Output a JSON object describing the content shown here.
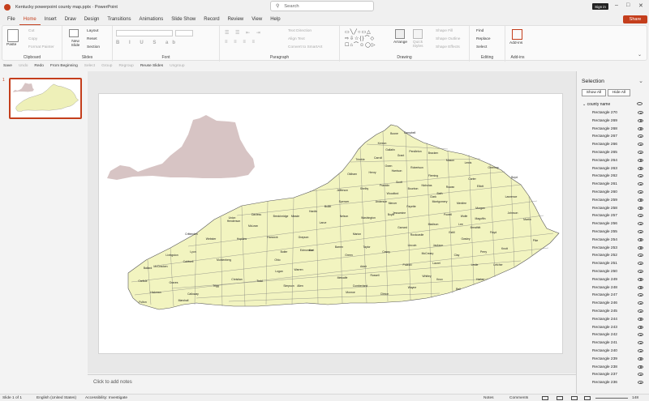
{
  "title": "Kentucky powerpoint county map.pptx  ·  PowerPoint",
  "search_placeholder": "Search",
  "sign_in": "Sign in",
  "share": "Share",
  "menu": [
    "File",
    "Home",
    "Insert",
    "Draw",
    "Design",
    "Transitions",
    "Animations",
    "Slide Show",
    "Record",
    "Review",
    "View",
    "Help"
  ],
  "ribbon": {
    "clipboard": {
      "paste": "Paste",
      "cut": "Cut",
      "copy": "Copy",
      "format_painter": "Format Painter",
      "label": "Clipboard"
    },
    "slides": {
      "new_slide": "New Slide",
      "layout": "Layout",
      "reset": "Reset",
      "section": "Section",
      "label": "Slides"
    },
    "font": {
      "label": "Font"
    },
    "paragraph": {
      "text_direction": "Text Direction",
      "align_text": "Align Text",
      "convert_smartart": "Convert to SmartArt",
      "label": "Paragraph"
    },
    "drawing": {
      "arrange": "Arrange",
      "quick_styles": "Quick Styles",
      "shape_fill": "Shape Fill",
      "shape_outline": "Shape Outline",
      "shape_effects": "Shape Effects",
      "label": "Drawing"
    },
    "editing": {
      "find": "Find",
      "replace": "Replace",
      "select": "Select",
      "label": "Editing"
    },
    "addins": {
      "addins": "Add-ins",
      "label": "Add-ins"
    }
  },
  "qat": [
    "Save",
    "Undo",
    "Redo",
    "From Beginning",
    "Select",
    "Group",
    "Regroup",
    "Reuse Slides",
    "Ungroup"
  ],
  "slide_number": "1",
  "notes_placeholder": "Click to add notes",
  "selection": {
    "title": "Selection",
    "show_all": "Show All",
    "hide_all": "Hide All",
    "root": "county name",
    "items": [
      "Rectangle 270",
      "Rectangle 269",
      "Rectangle 268",
      "Rectangle 267",
      "Rectangle 266",
      "Rectangle 265",
      "Rectangle 264",
      "Rectangle 263",
      "Rectangle 262",
      "Rectangle 261",
      "Rectangle 260",
      "Rectangle 259",
      "Rectangle 258",
      "Rectangle 257",
      "Rectangle 256",
      "Rectangle 255",
      "Rectangle 254",
      "Rectangle 253",
      "Rectangle 252",
      "Rectangle 251",
      "Rectangle 250",
      "Rectangle 249",
      "Rectangle 248",
      "Rectangle 247",
      "Rectangle 246",
      "Rectangle 245",
      "Rectangle 244",
      "Rectangle 243",
      "Rectangle 242",
      "Rectangle 241",
      "Rectangle 240",
      "Rectangle 239",
      "Rectangle 238",
      "Rectangle 237",
      "Rectangle 236"
    ]
  },
  "status": {
    "slide": "Slide 1 of 1",
    "language": "English (United States)",
    "accessibility": "Accessibility: Investigate",
    "notes": "Notes",
    "comments": "Comments",
    "zoom": "148"
  },
  "colors": {
    "accent": "#c43e1c",
    "county_fill": "#f2f4c0",
    "silhouette": "#d7c4c4"
  },
  "counties": [
    "Boone",
    "Campbell",
    "Kenton",
    "Gallatin",
    "Grant",
    "Pendleton",
    "Bracken",
    "Mason",
    "Lewis",
    "Greenup",
    "Carroll",
    "Trimble",
    "Oldham",
    "Henry",
    "Owen",
    "Harrison",
    "Robertson",
    "Fleming",
    "Carter",
    "Boyd",
    "Rowan",
    "Elliott",
    "Lawrence",
    "Bath",
    "Menifee",
    "Morgan",
    "Johnson",
    "Martin",
    "Jefferson",
    "Shelby",
    "Franklin",
    "Scott",
    "Bourbon",
    "Nicholas",
    "Clark",
    "Montgomery",
    "Powell",
    "Wolfe",
    "Magoffin",
    "Floyd",
    "Pike",
    "Knott",
    "Letcher",
    "Perry",
    "Breathitt",
    "Lee",
    "Estill",
    "Owsley",
    "Madison",
    "Jackson",
    "Clay",
    "Leslie",
    "Harlan",
    "Bell",
    "Knox",
    "Whitley",
    "Laurel",
    "McCreary",
    "Rockcastle",
    "Garrard",
    "Lincoln",
    "Pulaski",
    "Wayne",
    "Clinton",
    "Cumberland",
    "Russell",
    "Casey",
    "Adair",
    "Metcalfe",
    "Monroe",
    "Taylor",
    "Green",
    "Marion",
    "Boyle",
    "Mercer",
    "Anderson",
    "Woodford",
    "Fayette",
    "Jessamine",
    "Washington",
    "Nelson",
    "Spencer",
    "Bullitt",
    "Hardin",
    "Meade",
    "Breckinridge",
    "Larue",
    "Hart",
    "Barren",
    "Allen",
    "Simpson",
    "Warren",
    "Edmonson",
    "Butler",
    "Logan",
    "Todd",
    "Christian",
    "Trigg",
    "Calloway",
    "Marshall",
    "Graves",
    "Hickman",
    "Fulton",
    "Carlisle",
    "Ballard",
    "McCracken",
    "Livingston",
    "Lyon",
    "Caldwell",
    "Crittenden",
    "Union",
    "Webster",
    "Hopkins",
    "Muhlenberg",
    "McLean",
    "Daviess",
    "Henderson",
    "Hancock",
    "Ohio",
    "Grayson"
  ]
}
